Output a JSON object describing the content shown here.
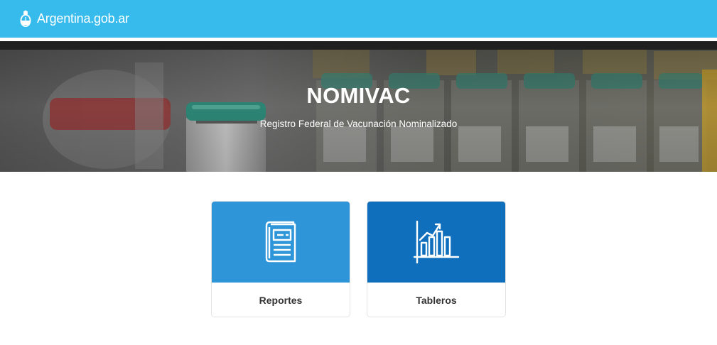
{
  "header": {
    "brand_text": "Argentina.gob.ar",
    "brand_icon": "argentina-coat-of-arms-icon",
    "background_color": "#37bbed"
  },
  "hero": {
    "title": "NOMIVAC",
    "subtitle": "Registro Federal de Vacunación Nominalizado"
  },
  "cards": [
    {
      "label": "Reportes",
      "icon": "report-book-icon",
      "color": "#2e95d8"
    },
    {
      "label": "Tableros",
      "icon": "bar-chart-icon",
      "color": "#0f6fbd"
    }
  ]
}
